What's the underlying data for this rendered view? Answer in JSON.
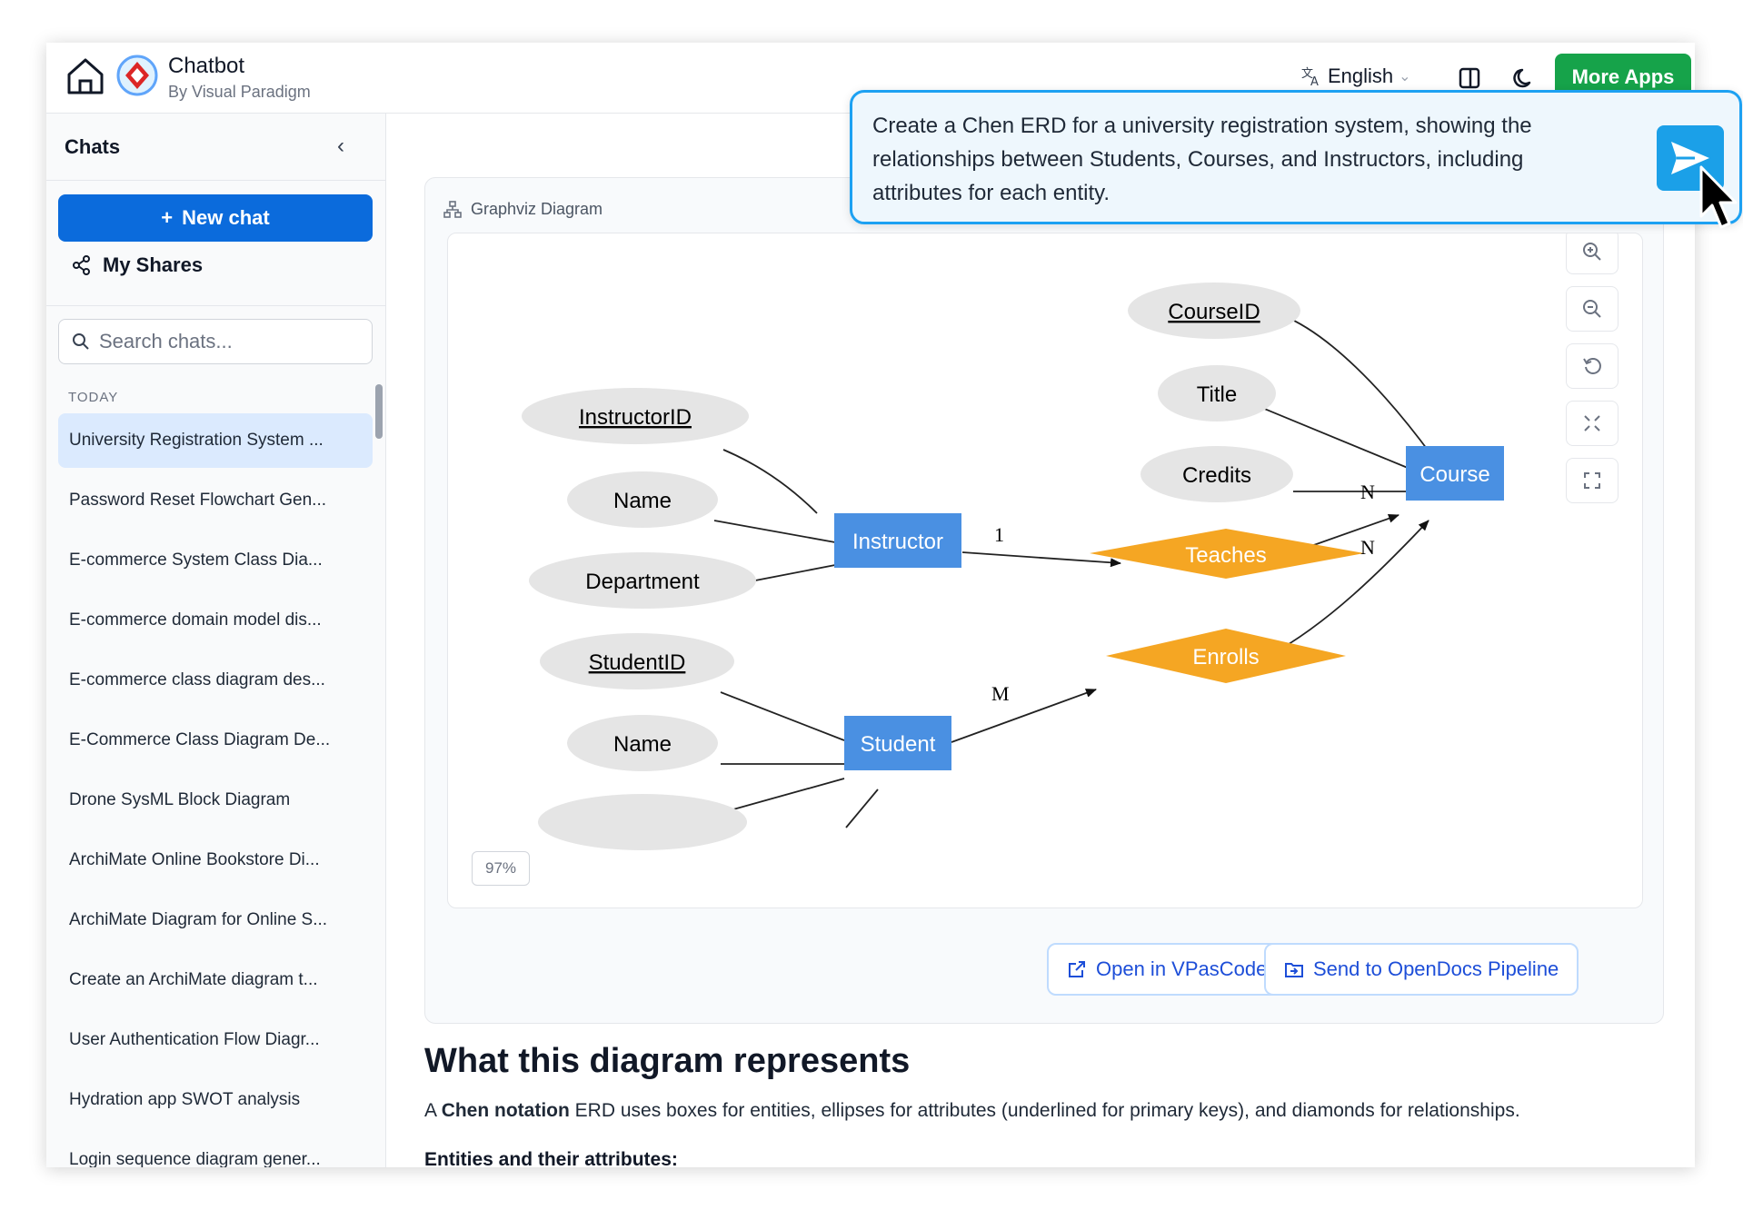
{
  "header": {
    "app_title": "Chatbot",
    "app_subtitle": "By Visual Paradigm",
    "language": "English",
    "more_apps_label": "More Apps"
  },
  "sidebar": {
    "title": "Chats",
    "new_chat_label": "New chat",
    "my_shares_label": "My Shares",
    "search_placeholder": "Search chats...",
    "section_label": "TODAY",
    "chats": [
      "University Registration System ...",
      "Password Reset Flowchart Gen...",
      "E-commerce System Class Dia...",
      "E-commerce domain model dis...",
      "E-commerce class diagram des...",
      "E-Commerce Class Diagram De...",
      "Drone SysML Block Diagram",
      "ArchiMate Online Bookstore Di...",
      "ArchiMate Diagram for Online S...",
      "Create an ArchiMate diagram t...",
      "User Authentication Flow Diagr...",
      "Hydration app SWOT analysis",
      "Login sequence diagram gener..."
    ]
  },
  "card": {
    "title": "Graphviz Diagram",
    "zoom": "97%",
    "open_label": "Open in VPasCode",
    "send_label": "Send to OpenDocs Pipeline"
  },
  "diagram": {
    "entities": {
      "instructor": "Instructor",
      "course": "Course",
      "student": "Student"
    },
    "relationships": {
      "teaches": "Teaches",
      "enrolls": "Enrolls"
    },
    "attributes": {
      "course_id": "CourseID",
      "title": "Title",
      "credits": "Credits",
      "instructor_id": "InstructorID",
      "instructor_name": "Name",
      "department": "Department",
      "student_id": "StudentID",
      "student_name": "Name"
    },
    "cardinalities": {
      "instructor_teaches": "1",
      "teaches_course": "N",
      "enrolls_course": "N",
      "student_enrolls": "M"
    },
    "colors": {
      "entity": "#4a90e2",
      "relationship": "#f5a623",
      "attribute": "#e5e5e5"
    }
  },
  "description": {
    "heading": "What this diagram represents",
    "para_prefix": "A ",
    "para_bold": "Chen notation",
    "para_rest": " ERD uses boxes for entities, ellipses for attributes (underlined for primary keys), and diamonds for relationships.",
    "subheading": "Entities and their attributes:"
  },
  "prompt": {
    "text": "Create a Chen ERD for a university registration system, showing the relationships between Students, Courses, and Instructors, including attributes for each entity."
  }
}
